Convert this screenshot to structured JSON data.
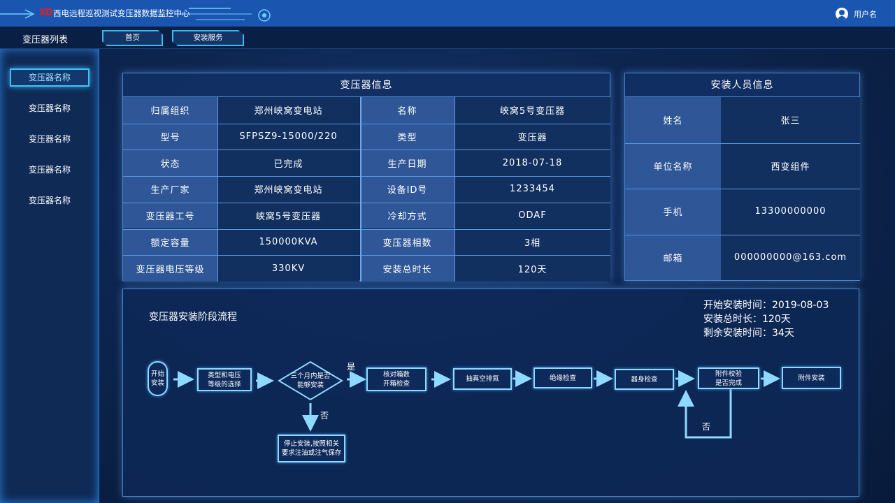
{
  "topbar": {
    "logo": "XD",
    "title": "西电远程巡视测试变压器数据监控中心",
    "username": "用户名"
  },
  "navbar": {
    "list_title": "变压器列表",
    "tabs": [
      "首页",
      "安装服务"
    ]
  },
  "sidebar": {
    "items": [
      "变压器名称",
      "变压器名称",
      "变压器名称",
      "变压器名称",
      "变压器名称"
    ],
    "active_index": 0
  },
  "transformer_panel": {
    "title": "变压器信息",
    "left": [
      {
        "label": "归属组织",
        "value": "郑州峡窝变电站"
      },
      {
        "label": "型号",
        "value": "SFPSZ9-15000/220"
      },
      {
        "label": "状态",
        "value": "已完成"
      },
      {
        "label": "生产厂家",
        "value": "郑州峡窝变电站"
      },
      {
        "label": "变压器工号",
        "value": "峡窝5号变压器"
      },
      {
        "label": "额定容量",
        "value": "150000KVA"
      },
      {
        "label": "变压器电压等级",
        "value": "330KV"
      }
    ],
    "right": [
      {
        "label": "名称",
        "value": "峡窝5号变压器"
      },
      {
        "label": "类型",
        "value": "变压器"
      },
      {
        "label": "生产日期",
        "value": "2018-07-18"
      },
      {
        "label": "设备ID号",
        "value": "1233454"
      },
      {
        "label": "冷却方式",
        "value": "ODAF"
      },
      {
        "label": "变压器相数",
        "value": "3相"
      },
      {
        "label": "安装总时长",
        "value": "120天"
      }
    ]
  },
  "installer_panel": {
    "title": "安装人员信息",
    "rows": [
      {
        "label": "姓名",
        "value": "张三"
      },
      {
        "label": "单位名称",
        "value": "西变组件"
      },
      {
        "label": "手机",
        "value": "13300000000"
      },
      {
        "label": "邮箱",
        "value": "000000000@163.com"
      }
    ]
  },
  "flow": {
    "title": "变压器安装阶段流程",
    "times": [
      "开始安装时间：2019-08-03",
      "安装总时长：120天",
      "剩余安装时间：34天"
    ],
    "start": "开始\n安装",
    "steps": [
      "类型和电压\n等级的选择",
      "三个月内是否\n能够安装",
      "核对箱数\n开箱检查",
      "抽真空排氮",
      "绝缘检查",
      "器身检查",
      "附件校验\n是否完成",
      "附件安装"
    ],
    "stop_box": "停止安装,按照相关\n要求注油或注气保存",
    "yes": "是",
    "no": "否",
    "no2": "否"
  },
  "colors": {
    "accent": "#3fb7f0",
    "topbar": "#1a56b0",
    "label_bg": "#2f5797",
    "value_bg": "#12305f"
  }
}
